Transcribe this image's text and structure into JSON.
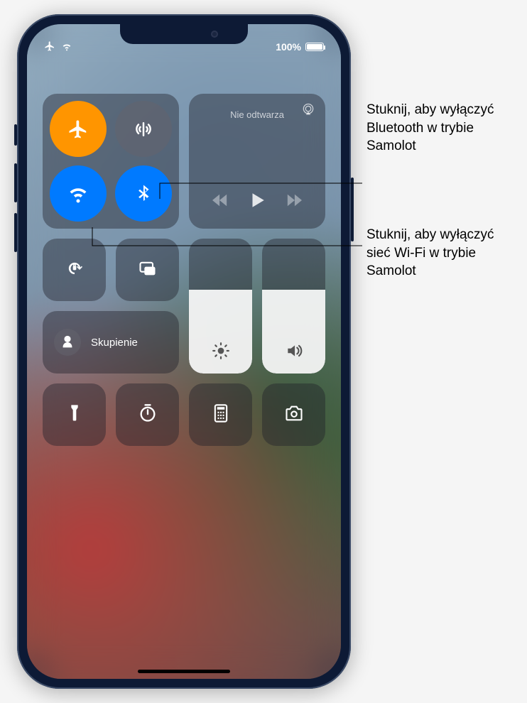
{
  "statusbar": {
    "battery_pct": "100%"
  },
  "connectivity": {
    "airplane": {
      "name": "airplane-icon",
      "active_color": "#ff9500"
    },
    "cellular": {
      "name": "cellular-icon"
    },
    "wifi": {
      "name": "wifi-icon",
      "active_color": "#007aff"
    },
    "bluetooth": {
      "name": "bluetooth-icon",
      "active_color": "#007aff"
    }
  },
  "music": {
    "now_playing_label": "Nie odtwarza"
  },
  "focus": {
    "label": "Skupienie"
  },
  "sliders": {
    "brightness_pct": 62,
    "volume_pct": 62
  },
  "callouts": {
    "bluetooth": "Stuknij, aby wyłączyć Bluetooth w trybie Samolot",
    "wifi": "Stuknij, aby wyłączyć sieć Wi-Fi w trybie Samolot"
  }
}
